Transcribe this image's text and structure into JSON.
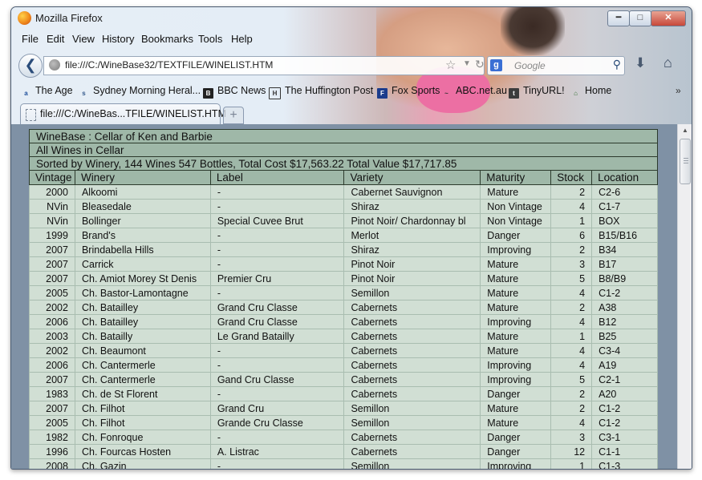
{
  "window": {
    "title": "Mozilla Firefox"
  },
  "menus": [
    "File",
    "Edit",
    "View",
    "History",
    "Bookmarks",
    "Tools",
    "Help"
  ],
  "nav": {
    "url": "file:///C:/WineBase32/TEXTFILE/WINELIST.HTM",
    "search_placeholder": "Google",
    "search_engine": "g"
  },
  "bookmarks": [
    {
      "label": "The Age",
      "icon": "the-age-icon"
    },
    {
      "label": "Sydney Morning Heral...",
      "icon": "smh-icon"
    },
    {
      "label": "BBC News",
      "icon": "bbc-icon"
    },
    {
      "label": "The Huffington Post",
      "icon": "huffpost-icon"
    },
    {
      "label": "Fox Sports",
      "icon": "fox-icon"
    },
    {
      "label": "ABC.net.au",
      "icon": "abc-icon"
    },
    {
      "label": "TinyURL!",
      "icon": "tinyurl-icon"
    },
    {
      "label": "Home",
      "icon": "home-bookmark-icon"
    }
  ],
  "bookmarks_more": "»",
  "tab": {
    "title": "file:///C:/WineBas...TFILE/WINELIST.HTM"
  },
  "page": {
    "header": "WineBase : Cellar of Ken and Barbie",
    "subheader": "All Wines in Cellar",
    "summary": "Sorted by Winery, 144 Wines 547 Bottles, Total Cost $17,563.22 Total Value $17,717.85",
    "columns": [
      "Vintage",
      "Winery",
      "Label",
      "Variety",
      "Maturity",
      "Stock",
      "Location"
    ],
    "rows": [
      [
        "2000",
        "Alkoomi",
        "-",
        "Cabernet Sauvignon",
        "Mature",
        "2",
        "C2-6"
      ],
      [
        "NVin",
        "Bleasedale",
        "-",
        "Shiraz",
        "Non Vintage",
        "4",
        "C1-7"
      ],
      [
        "NVin",
        "Bollinger",
        "Special Cuvee Brut",
        "Pinot Noir/ Chardonnay bl",
        "Non Vintage",
        "1",
        "BOX"
      ],
      [
        "1999",
        "Brand's",
        "-",
        "Merlot",
        "Danger",
        "6",
        "B15/B16"
      ],
      [
        "2007",
        "Brindabella Hills",
        "-",
        "Shiraz",
        "Improving",
        "2",
        "B34"
      ],
      [
        "2007",
        "Carrick",
        "-",
        "Pinot Noir",
        "Mature",
        "3",
        "B17"
      ],
      [
        "2007",
        "Ch. Amiot Morey St Denis",
        "Premier Cru",
        "Pinot Noir",
        "Mature",
        "5",
        "B8/B9"
      ],
      [
        "2005",
        "Ch. Bastor-Lamontagne",
        "-",
        "Semillon",
        "Mature",
        "4",
        "C1-2"
      ],
      [
        "2002",
        "Ch. Batailley",
        "Grand Cru Classe",
        "Cabernets",
        "Mature",
        "2",
        "A38"
      ],
      [
        "2006",
        "Ch. Batailley",
        "Grand Cru Classe",
        "Cabernets",
        "Improving",
        "4",
        "B12"
      ],
      [
        "2003",
        "Ch. Batailly",
        "Le Grand Batailly",
        "Cabernets",
        "Mature",
        "1",
        "B25"
      ],
      [
        "2002",
        "Ch. Beaumont",
        "-",
        "Cabernets",
        "Mature",
        "4",
        "C3-4"
      ],
      [
        "2006",
        "Ch. Cantermerle",
        "-",
        "Cabernets",
        "Improving",
        "4",
        "A19"
      ],
      [
        "2007",
        "Ch. Cantermerle",
        "Gand Cru Classe",
        "Cabernets",
        "Improving",
        "5",
        "C2-1"
      ],
      [
        "1983",
        "Ch. de St Florent",
        "-",
        "Cabernets",
        "Danger",
        "2",
        "A20"
      ],
      [
        "2007",
        "Ch. Filhot",
        "Grand Cru",
        "Semillon",
        "Mature",
        "2",
        "C1-2"
      ],
      [
        "2005",
        "Ch. Filhot",
        "Grande Cru Classe",
        "Semillon",
        "Mature",
        "4",
        "C1-2"
      ],
      [
        "1982",
        "Ch. Fonroque",
        "-",
        "Cabernets",
        "Danger",
        "3",
        "C3-1"
      ],
      [
        "1996",
        "Ch. Fourcas Hosten",
        "A. Listrac",
        "Cabernets",
        "Danger",
        "12",
        "C1-1"
      ],
      [
        "2008",
        "Ch. Gazin",
        "-",
        "Semillon",
        "Improving",
        "1",
        "C1-3"
      ]
    ]
  }
}
